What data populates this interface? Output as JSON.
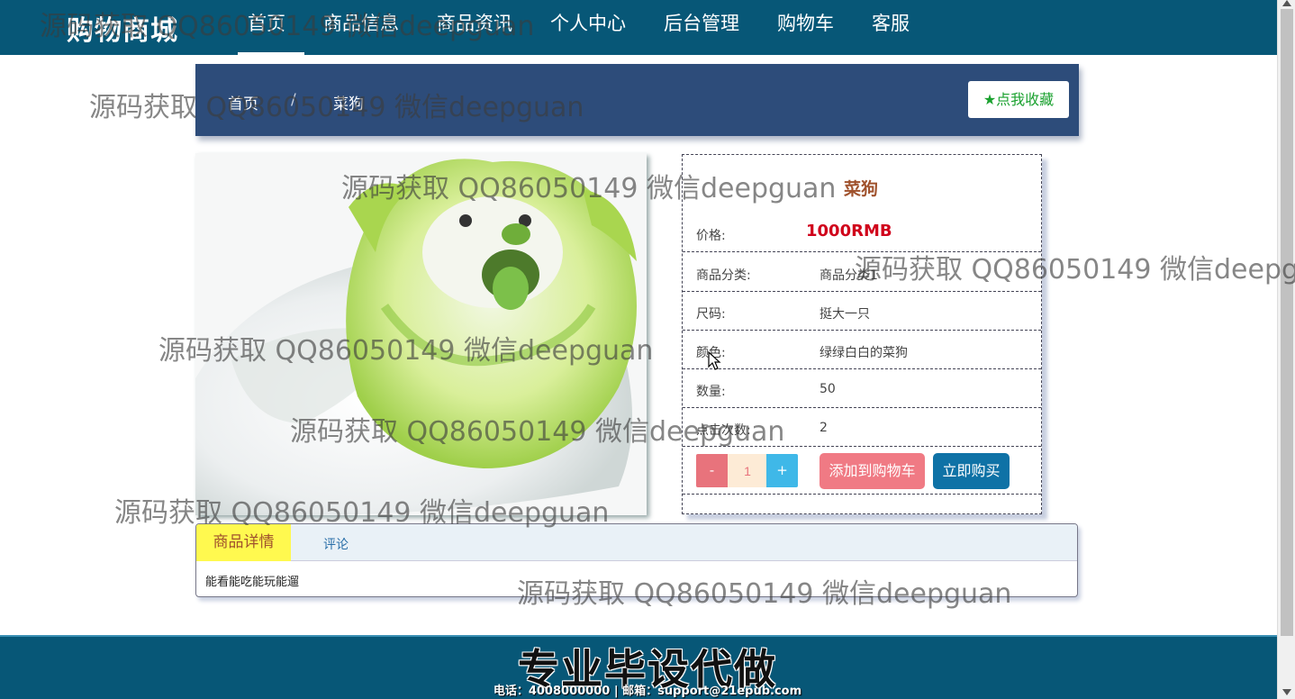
{
  "header": {
    "brand": "购物商城",
    "nav": [
      "首页",
      "商品信息",
      "商品资讯",
      "个人中心",
      "后台管理",
      "购物车",
      "客服"
    ]
  },
  "breadcrumb": {
    "home": "首页",
    "separator": "/",
    "current": "菜狗",
    "favorite_label": "点我收藏"
  },
  "product": {
    "name": "菜狗",
    "price_label": "价格:",
    "price": "1000RMB",
    "rows": [
      {
        "label": "商品分类:",
        "value": "商品分类1"
      },
      {
        "label": "尺码:",
        "value": "挺大一只"
      },
      {
        "label": "颜色:",
        "value": "绿绿白白的菜狗"
      },
      {
        "label": "数量:",
        "value": "50"
      },
      {
        "label": "点击次数:",
        "value": "2"
      }
    ],
    "qty_minus": "-",
    "qty_value": "1",
    "qty_plus": "+",
    "add_to_cart": "添加到购物车",
    "buy_now": "立即购买"
  },
  "tabs": {
    "detail": "商品详情",
    "comment": "评论",
    "content": "能看能吃能玩能遛"
  },
  "footer": {
    "title": "专业毕设代做",
    "contact": "电话：4008000000 | 邮箱：support@21epub.com"
  },
  "watermark": "源码获取 QQ86050149 微信deepguan",
  "colors": {
    "header_bg": "#075777",
    "breadcrumb_bg": "#2d4c7a",
    "price": "#d0021b",
    "cart_button": "#f07a84",
    "buy_button": "#0f72a6",
    "active_tab": "#fff94f"
  }
}
